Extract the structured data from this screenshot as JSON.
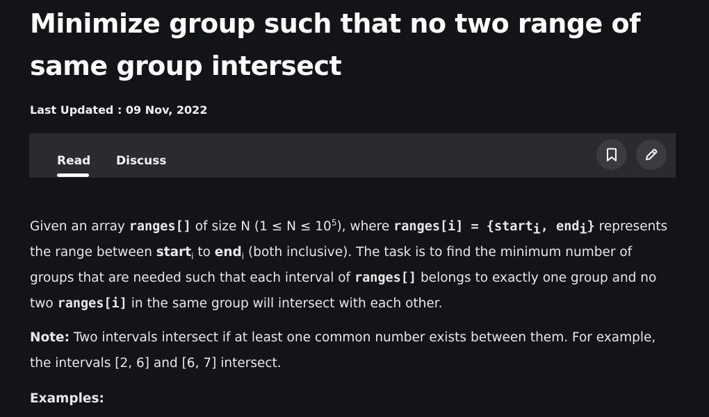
{
  "article": {
    "title": "Minimize group such that no two range of same group intersect",
    "last_updated": "Last Updated : 09 Nov, 2022"
  },
  "tabs": {
    "read_label": "Read",
    "discuss_label": "Discuss"
  },
  "actions": {
    "bookmark_icon": "bookmark-icon",
    "edit_icon": "pencil-icon"
  },
  "body": {
    "p1": {
      "t1": "Given an array ",
      "c1": "ranges[]",
      "t2": " of size N (1 ≤ N ≤ 10",
      "sup1": "5",
      "t3": "), where ",
      "c2": "ranges[i] = {start",
      "sub1": "i",
      "c3": ", end",
      "sub2": "i",
      "c4": "}",
      "t4": " represents the range between ",
      "b1": "start",
      "sub3": "i",
      "t5": " to ",
      "b2": "end",
      "sub4": "i",
      "t6": " (both inclusive). The task is to find the minimum number of groups that are needed such that each interval of ",
      "c5": "ranges[]",
      "t7": " belongs to exactly one group and no two ",
      "c6": "ranges[i]",
      "t8": " in the same group will intersect with each other."
    },
    "note": {
      "label": "Note:",
      "text": " Two intervals intersect if at least one common number exists between them. For example, the intervals [2, 6] and [6, 7] intersect."
    },
    "examples_label": "Examples:"
  },
  "colors": {
    "background": "#131417",
    "tabbar": "#2a2b2e",
    "icon_button": "#3b3c40",
    "text": "#e8e8e8"
  }
}
